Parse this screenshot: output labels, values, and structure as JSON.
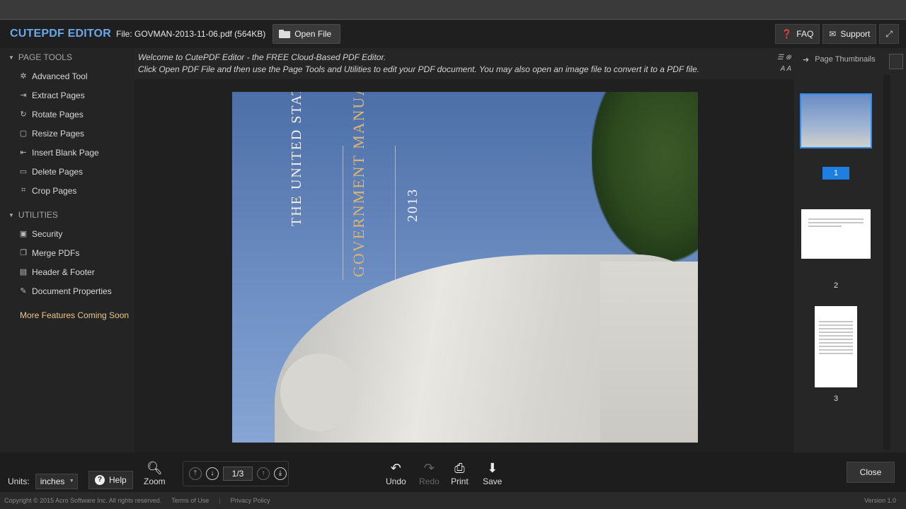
{
  "app": {
    "logo": "CUTEPDF EDITOR",
    "file_label": "File: GOVMAN-2013-11-06.pdf (564KB)",
    "open_file": "Open File",
    "faq": "FAQ",
    "support": "Support"
  },
  "sidebar": {
    "page_tools_title": "PAGE TOOLS",
    "page_tools": [
      {
        "label": "Advanced Tool"
      },
      {
        "label": "Extract Pages"
      },
      {
        "label": "Rotate Pages"
      },
      {
        "label": "Resize Pages"
      },
      {
        "label": "Insert Blank Page"
      },
      {
        "label": "Delete Pages"
      },
      {
        "label": "Crop Pages"
      }
    ],
    "utilities_title": "UTILITIES",
    "utilities": [
      {
        "label": "Security"
      },
      {
        "label": "Merge PDFs"
      },
      {
        "label": "Header & Footer"
      },
      {
        "label": "Document Properties"
      }
    ],
    "coming_soon": "More Features Coming Soon"
  },
  "message": {
    "line1": "Welcome to CutePDF Editor - the FREE Cloud-Based PDF Editor.",
    "line2": "Click Open PDF File and then use the Page Tools and Utilities to edit your PDF document. You may also open an image file to convert it to a PDF file."
  },
  "document": {
    "cover_line1": "THE UNITED STATES",
    "cover_line2": "GOVERNMENT MANUAL",
    "cover_year": "2013"
  },
  "thumbnails": {
    "header": "Page Thumbnails",
    "pages": [
      "1",
      "2",
      "3"
    ],
    "selected": "1"
  },
  "toolbar": {
    "units_label": "Units:",
    "units_value": "inches",
    "help": "Help",
    "zoom": "Zoom",
    "page_indicator": "1/3",
    "undo": "Undo",
    "redo": "Redo",
    "print": "Print",
    "save": "Save",
    "close": "Close"
  },
  "footer": {
    "copyright": "Copyright © 2015 Acro Software Inc. All rights reserved.",
    "terms": "Terms of Use",
    "privacy": "Privacy Policy",
    "version": "Version 1.0"
  }
}
